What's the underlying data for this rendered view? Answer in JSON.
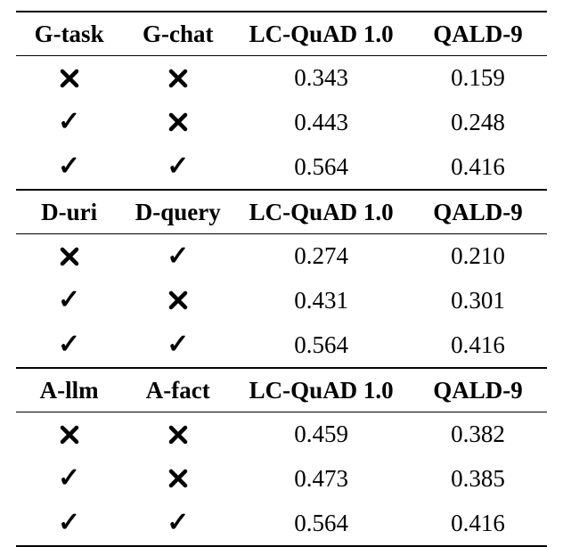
{
  "chart_data": [
    {
      "type": "table",
      "columns": [
        "G-task",
        "G-chat",
        "LC-QuAD 1.0",
        "QALD-9"
      ],
      "rows": [
        [
          "cross",
          "cross",
          0.343,
          0.159
        ],
        [
          "check",
          "cross",
          0.443,
          0.248
        ],
        [
          "check",
          "check",
          0.564,
          0.416
        ]
      ]
    },
    {
      "type": "table",
      "columns": [
        "D-uri",
        "D-query",
        "LC-QuAD 1.0",
        "QALD-9"
      ],
      "rows": [
        [
          "cross",
          "check",
          0.274,
          0.21
        ],
        [
          "check",
          "cross",
          0.431,
          0.301
        ],
        [
          "check",
          "check",
          0.564,
          0.416
        ]
      ]
    },
    {
      "type": "table",
      "columns": [
        "A-llm",
        "A-fact",
        "LC-QuAD 1.0",
        "QALD-9"
      ],
      "rows": [
        [
          "cross",
          "cross",
          0.459,
          0.382
        ],
        [
          "check",
          "cross",
          0.473,
          0.385
        ],
        [
          "check",
          "check",
          0.564,
          0.416
        ]
      ]
    }
  ],
  "sections": {
    "s0": {
      "h0": "G-task",
      "h1": "G-chat",
      "h2": "LC-QuAD 1.0",
      "h3": "QALD-9",
      "r0": {
        "v2": "0.343",
        "v3": "0.159"
      },
      "r1": {
        "v2": "0.443",
        "v3": "0.248"
      },
      "r2": {
        "v2": "0.564",
        "v3": "0.416"
      }
    },
    "s1": {
      "h0": "D-uri",
      "h1": "D-query",
      "h2": "LC-QuAD 1.0",
      "h3": "QALD-9",
      "r0": {
        "v2": "0.274",
        "v3": "0.210"
      },
      "r1": {
        "v2": "0.431",
        "v3": "0.301"
      },
      "r2": {
        "v2": "0.564",
        "v3": "0.416"
      }
    },
    "s2": {
      "h0": "A-llm",
      "h1": "A-fact",
      "h2": "LC-QuAD 1.0",
      "h3": "QALD-9",
      "r0": {
        "v2": "0.459",
        "v3": "0.382"
      },
      "r1": {
        "v2": "0.473",
        "v3": "0.385"
      },
      "r2": {
        "v2": "0.564",
        "v3": "0.416"
      }
    }
  }
}
